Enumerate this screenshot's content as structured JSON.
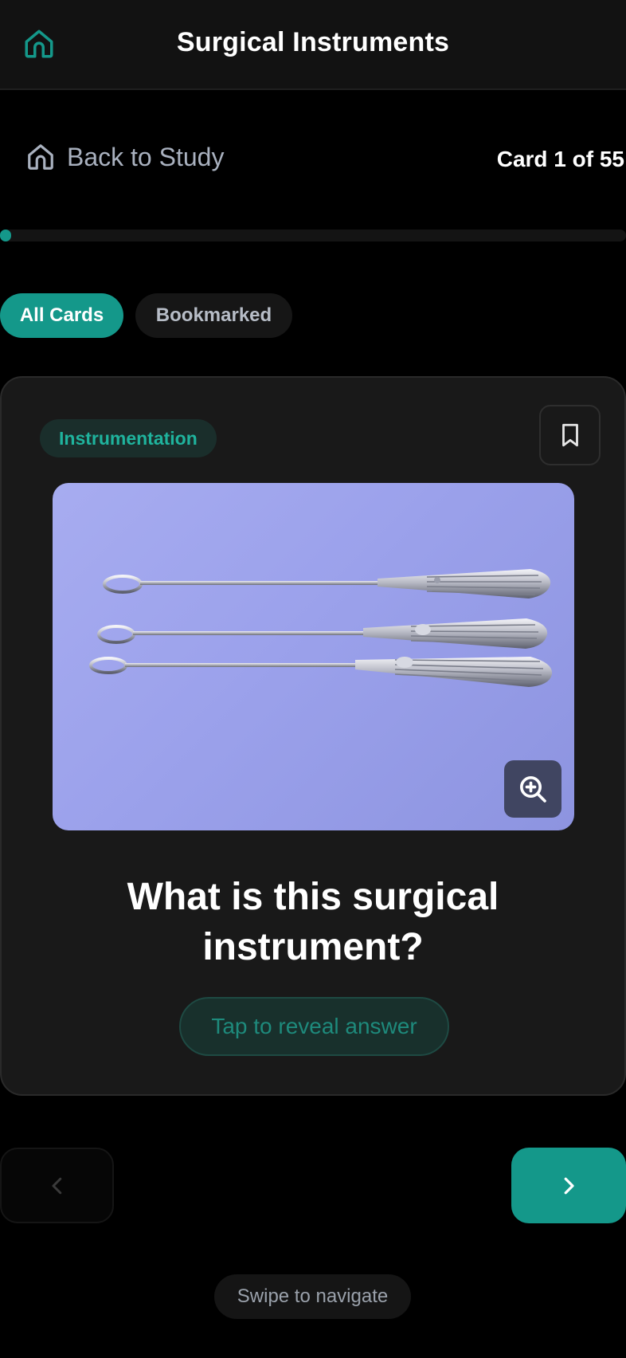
{
  "header": {
    "title": "Surgical Instruments",
    "home_icon": "home-icon"
  },
  "study_nav": {
    "back_label": "Back to Study",
    "back_icon": "home-icon",
    "counter": "Card 1 of 55"
  },
  "progress": {
    "fraction": 0.018
  },
  "filters": {
    "all_label": "All Cards",
    "bookmarked_label": "Bookmarked",
    "selected": "All Cards"
  },
  "card": {
    "category": "Instrumentation",
    "bookmark_icon": "bookmark-icon",
    "image_alt": "Three curettes with striped handles on a blue drape",
    "zoom_icon": "zoom-in-icon",
    "question": "What is this surgical instrument?",
    "reveal_label": "Tap to reveal answer"
  },
  "navigation": {
    "prev_icon": "chevron-left-icon",
    "next_icon": "chevron-right-icon",
    "swipe_hint": "Swipe to navigate"
  },
  "colors": {
    "accent": "#14988a",
    "background": "#000000",
    "card": "#191919"
  }
}
